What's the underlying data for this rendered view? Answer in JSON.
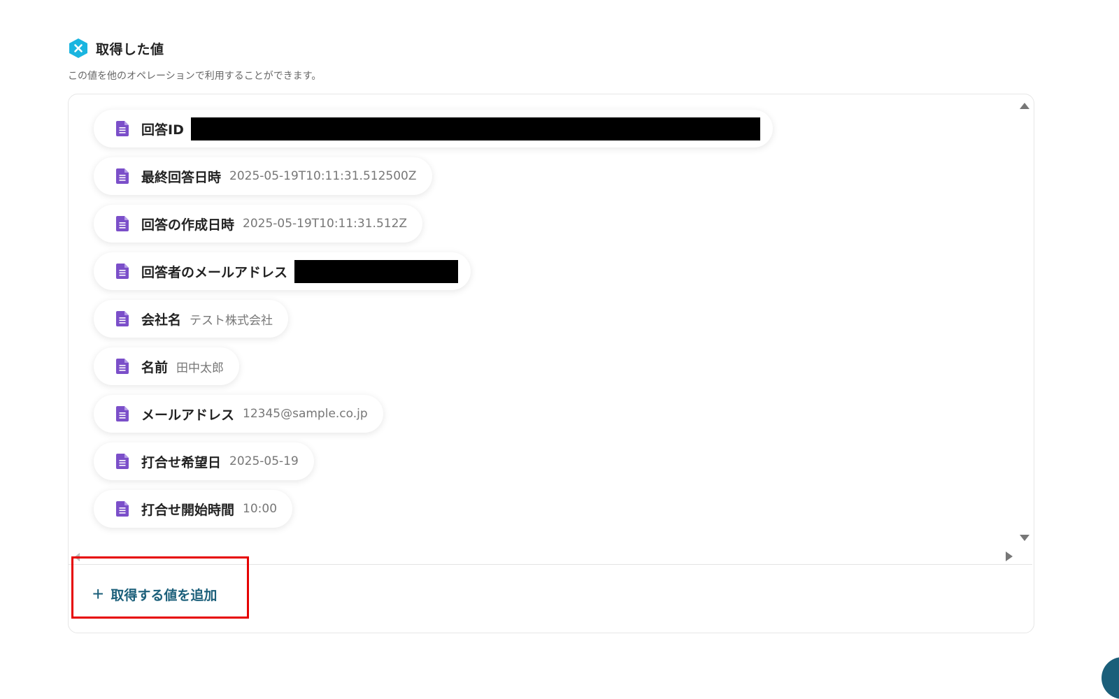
{
  "header": {
    "title": "取得した値",
    "description": "この値を他のオペレーションで利用することができます。",
    "icon": "close-hexagon-icon",
    "accent_color": "#1ab5e0"
  },
  "values": [
    {
      "label": "回答ID",
      "value": "",
      "redacted": true
    },
    {
      "label": "最終回答日時",
      "value": "2025-05-19T10:11:31.512500Z",
      "redacted": false
    },
    {
      "label": "回答の作成日時",
      "value": "2025-05-19T10:11:31.512Z",
      "redacted": false
    },
    {
      "label": "回答者のメールアドレス",
      "value": "",
      "redacted": true
    },
    {
      "label": "会社名",
      "value": "テスト株式会社",
      "redacted": false
    },
    {
      "label": "名前",
      "value": "田中太郎",
      "redacted": false
    },
    {
      "label": "メールアドレス",
      "value": "12345@sample.co.jp",
      "redacted": false
    },
    {
      "label": "打合せ希望日",
      "value": "2025-05-19",
      "redacted": false
    },
    {
      "label": "打合せ開始時間",
      "value": "10:00",
      "redacted": false
    }
  ],
  "value_icon": "document-icon",
  "value_icon_color": "#7b4fc9",
  "add_button": {
    "label": "取得する値を追加",
    "icon": "plus-icon",
    "color": "#1b5f7a"
  },
  "highlight_color": "#e60000"
}
